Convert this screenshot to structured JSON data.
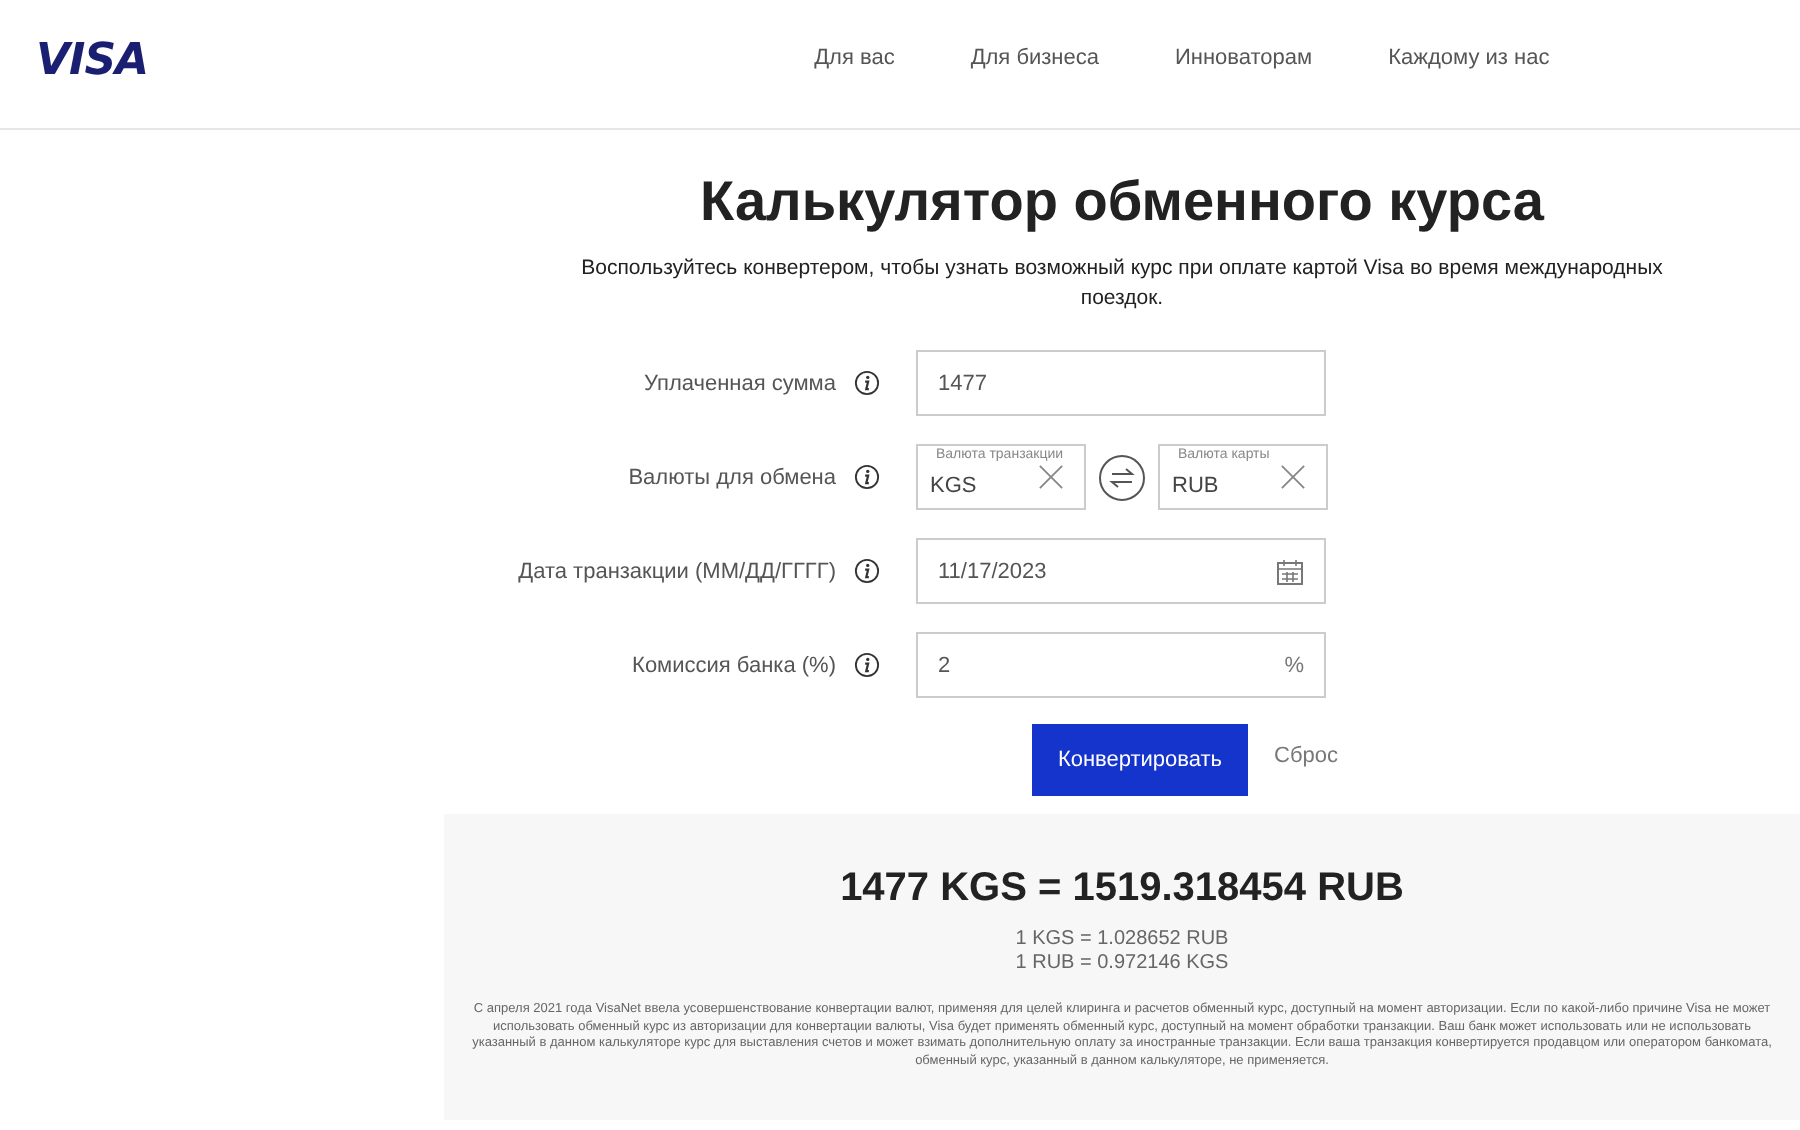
{
  "header": {
    "logo": "VISA",
    "nav": [
      "Для вас",
      "Для бизнеса",
      "Инноваторам",
      "Каждому из нас"
    ]
  },
  "title": "Калькулятор обменного курса",
  "subtitle": "Воспользуйтесь конвертером, чтобы узнать возможный курс при оплате картой Visa во время международных поездок.",
  "form": [
    {
      "kind": "amount",
      "label": "Уплаченная сумма",
      "value": "1477"
    },
    {
      "kind": "currencies",
      "label": "Валюты для обмена",
      "from_label": "Валюта транзакции",
      "from": "KGS",
      "to_label": "Валюта карты",
      "to": "RUB"
    },
    {
      "kind": "date",
      "label": "Дата транзакции (ММ/ДД/ГГГГ)",
      "value": "11/17/2023"
    },
    {
      "kind": "percent",
      "label": "Комиссия банка (%)",
      "value": "2",
      "suffix": "%"
    }
  ],
  "buttons": {
    "convert": "Конвертировать",
    "reset": "Сброс"
  },
  "result": {
    "main": "1477 KGS = 1519.318454 RUB",
    "rates": [
      "1 KGS = 1.028652 RUB",
      "1 RUB = 0.972146 KGS"
    ],
    "disclaimer": "С апреля 2021 года VisaNet ввела усовершенствование конвертации валют, применяя для целей клиринга и расчетов обменный курс, доступный на момент авторизации. Если по какой-либо причине Visa не может использовать обменный курс из авторизации для конвертации валюты, Visa будет применять обменный курс, доступный на момент обработки транзакции. Ваш банк может использовать или не использовать указанный в данном калькуляторе курс для выставления счетов и может взимать дополнительную оплату за иностранные транзакции. Если ваша транзакция конвертируется продавцом или оператором банкомата, обменный курс, указанный в данном калькуляторе, не применяется."
  }
}
